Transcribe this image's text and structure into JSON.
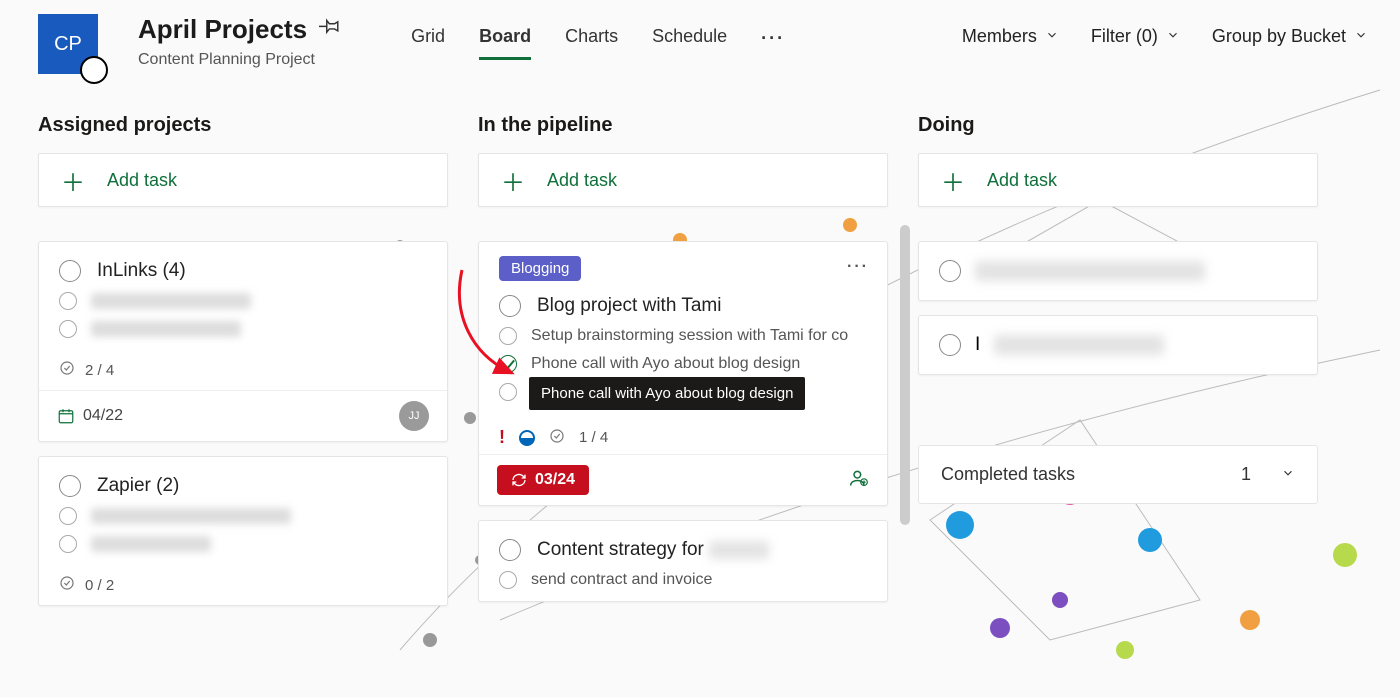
{
  "header": {
    "logo_initials": "CP",
    "plan_title": "April Projects",
    "plan_subtitle": "Content Planning Project",
    "tabs": {
      "grid": "Grid",
      "board": "Board",
      "charts": "Charts",
      "schedule": "Schedule"
    },
    "controls": {
      "members": "Members",
      "filter": "Filter (0)",
      "group_by": "Group by Bucket"
    }
  },
  "add_task_label": "Add task",
  "columns": {
    "assigned": {
      "title": "Assigned projects",
      "cards": [
        {
          "title": "InLinks (4)",
          "subtasks": [
            "redacted item one",
            "redacted item two"
          ],
          "checklist": "2 / 4",
          "date": "04/22",
          "avatar": "JJ"
        },
        {
          "title": "Zapier (2)",
          "subtasks": [
            "redacted item one longer",
            "redacted item"
          ],
          "checklist": "0 / 2"
        }
      ]
    },
    "pipeline": {
      "title": "In the pipeline",
      "cards": [
        {
          "tag": "Blogging",
          "title": "Blog project with Tami",
          "subtasks": [
            {
              "text": "Setup brainstorming session with Tami for co",
              "done": false
            },
            {
              "text": "Phone call with Ayo about blog design",
              "done": true
            },
            {
              "text": "",
              "done": false
            }
          ],
          "tooltip": "Phone call with Ayo about blog design",
          "checklist": "1 / 4",
          "overdue_date": "03/24"
        },
        {
          "title": "Content strategy for",
          "subtasks": [
            {
              "text": "send contract and invoice",
              "done": false
            }
          ]
        }
      ]
    },
    "doing": {
      "title": "Doing",
      "cards": [
        {
          "title_hidden": "redacted doing task one text"
        },
        {
          "title_prefix": "I",
          "title_hidden": "redacted doing two"
        }
      ],
      "completed_label": "Completed tasks",
      "completed_count": "1"
    }
  }
}
